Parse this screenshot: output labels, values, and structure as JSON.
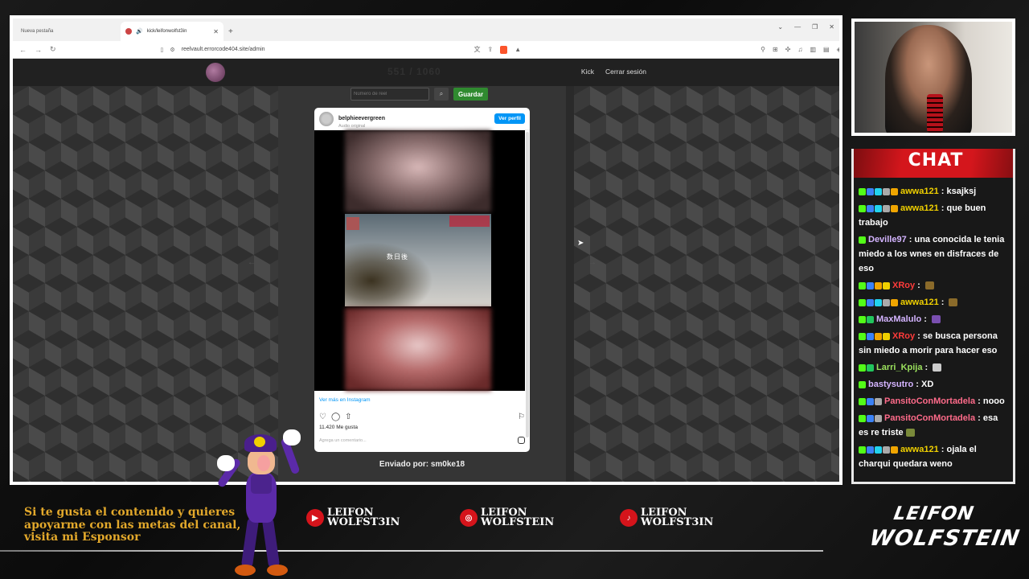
{
  "browser": {
    "tabs": [
      {
        "label": "Nueva pestaña",
        "active": false
      },
      {
        "label": "kick/leifonwolfst3in",
        "active": true
      }
    ],
    "new_tab": "+",
    "url": "reelvault.errorcode404.site/admin"
  },
  "site": {
    "counter": "551 / 1060",
    "nav": {
      "kick": "Kick",
      "logout": "Cerrar sesión"
    },
    "search": {
      "placeholder": "Número de reel",
      "save_label": "Guardar"
    },
    "instagram": {
      "username": "belphieevergreen",
      "audio": "Audio original",
      "profile_btn": "Ver perfil",
      "overlay_text": "数日後",
      "view_more": "Ver más en Instagram",
      "likes": "11.420 Me gusta",
      "comment_placeholder": "Agrega un comentario..."
    },
    "sender": "Enviado por: sm0ke18"
  },
  "chat": {
    "title": "CHAT",
    "messages": [
      {
        "user": "awwa121",
        "user_color": "#f0d000",
        "text": "ksajksj",
        "badges": [
          "#53fc18",
          "#3b82f6",
          "#22d3ee",
          "#aaa",
          "#f0a500"
        ]
      },
      {
        "user": "awwa121",
        "user_color": "#f0d000",
        "text": "que buen trabajo",
        "badges": [
          "#53fc18",
          "#3b82f6",
          "#22d3ee",
          "#aaa",
          "#f0a500"
        ]
      },
      {
        "user": "Deville97",
        "user_color": "#d4b4ff",
        "text": "una conocida le tenia miedo a los wnes en disfraces de eso",
        "badges": [
          "#53fc18"
        ]
      },
      {
        "user": "XRoy",
        "user_color": "#ff3b3b",
        "text": "",
        "emote": "#8a6a2a",
        "badges": [
          "#53fc18",
          "#3b82f6",
          "#f0a500",
          "#f0d000"
        ]
      },
      {
        "user": "awwa121",
        "user_color": "#f0d000",
        "text": "",
        "emote": "#8a6a2a",
        "badges": [
          "#53fc18",
          "#3b82f6",
          "#22d3ee",
          "#aaa",
          "#f0a500"
        ]
      },
      {
        "user": "MaxMalulo",
        "user_color": "#d4b4ff",
        "text": "",
        "emote": "#7a4fb0",
        "badges": [
          "#53fc18",
          "#22c55e"
        ]
      },
      {
        "user": "XRoy",
        "user_color": "#ff3b3b",
        "text": "se busca persona sin miedo a morir para hacer eso",
        "badges": [
          "#53fc18",
          "#3b82f6",
          "#f0a500",
          "#f0d000"
        ]
      },
      {
        "user": "Larri_Kpija",
        "user_color": "#9be15d",
        "text": "",
        "emote": "#cccccc",
        "badges": [
          "#53fc18",
          "#22c55e"
        ]
      },
      {
        "user": "bastysutro",
        "user_color": "#d4b4ff",
        "text": "XD",
        "badges": [
          "#53fc18"
        ]
      },
      {
        "user": "PansitoConMortadela",
        "user_color": "#ff6b8a",
        "text": "nooo",
        "badges": [
          "#53fc18",
          "#3b82f6",
          "#aaa"
        ]
      },
      {
        "user": "PansitoConMortadela",
        "user_color": "#ff6b8a",
        "text": "esa es re triste",
        "emote": "#7a8a3a",
        "badges": [
          "#53fc18",
          "#3b82f6",
          "#aaa"
        ]
      },
      {
        "user": "awwa121",
        "user_color": "#f0d000",
        "text": "ojala el charqui quedara weno",
        "badges": [
          "#53fc18",
          "#3b82f6",
          "#22d3ee",
          "#aaa",
          "#f0a500"
        ]
      }
    ]
  },
  "overlay": {
    "sponsor_text": "Si te gusta el contenido y quieres apoyarme con las metas del canal, visita mi Esponsor",
    "socials": [
      {
        "platform": "youtube",
        "icon": "youtube-icon",
        "name_line1": "LEIFON",
        "name_line2": "WOLFST3IN"
      },
      {
        "platform": "instagram",
        "icon": "instagram-icon",
        "name_line1": "LEIFON",
        "name_line2": "WOLFSTEIN"
      },
      {
        "platform": "tiktok",
        "icon": "tiktok-icon",
        "name_line1": "LEIFON",
        "name_line2": "WOLFST3IN"
      }
    ],
    "brand": {
      "line1": "LEIFON",
      "line2": "WOLFSTEIN"
    }
  }
}
